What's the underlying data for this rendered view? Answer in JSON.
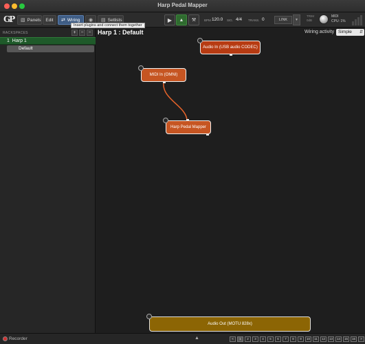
{
  "window": {
    "title": "Harp Pedal Mapper"
  },
  "toolbar": {
    "logo": "GP",
    "tabs": [
      {
        "label": "Panels",
        "icon": "panels-icon"
      },
      {
        "label": "Edit",
        "icon": ""
      },
      {
        "label": "Wiring",
        "icon": "wiring-icon"
      },
      {
        "label": "",
        "icon": "globe-icon"
      },
      {
        "label": "Setlists",
        "icon": "setlists-icon"
      }
    ],
    "tooltip": "Insert plugins and connect them together",
    "bpm_label": "BPM",
    "bpm_value": "120.0",
    "sig_label": "SIG.",
    "sig_value": "4/4",
    "trans_label": "TRANS.",
    "trans_value": "0",
    "link_label": "LINK",
    "trim_label": "TRIM",
    "trim_value": "0dB",
    "midi_label": "MIDI",
    "cpu_label": "CPU:",
    "cpu_value": "1%"
  },
  "sidebar": {
    "section_label": "RACKSPACES",
    "buttons": [
      "+",
      "−",
      "−"
    ],
    "rackspaces": [
      {
        "number": "1",
        "name": "Harp 1",
        "variations": [
          "Default"
        ]
      }
    ]
  },
  "main": {
    "title": "Harp 1 : Default",
    "wiring_activity_label": "Wiring activity",
    "wiring_activity_value": "Simple"
  },
  "nodes": {
    "audio_in": "Audio In (USB audio CODEC)",
    "midi_in": "MIDI In (OMNI)",
    "hpm": "Harp Pedal Mapper",
    "audio_out": "Audio Out (MOTU 828x)"
  },
  "bottom": {
    "recorder_label": "Recorder",
    "nav_left": "«",
    "pages": [
      "1",
      "2",
      "3",
      "4",
      "5",
      "6",
      "7",
      "8",
      "9",
      "10",
      "11",
      "12",
      "13",
      "14",
      "15",
      "16"
    ],
    "nav_right": "»",
    "active_page": "1"
  },
  "colors": {
    "audio_in_node": "#b73b12",
    "midi_node": "#c65522",
    "audio_out_node": "#8c6504",
    "rackspace_selected": "#1f5a2a",
    "wiring_tab": "#3f5d85"
  }
}
